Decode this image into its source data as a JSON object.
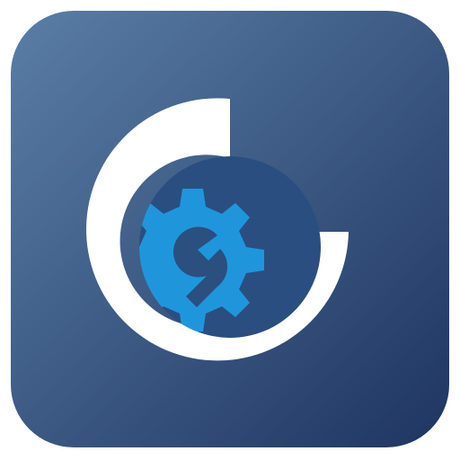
{
  "icon": {
    "name": "settings-gear-wrench-app-icon",
    "glyph_icon": "gear-wrench-icon",
    "colors": {
      "background_light": "#5A7EA6",
      "background_dark": "#1E3560",
      "ring": "#FFFFFF",
      "inner_disc": "#2A4E80",
      "gear": "#1F96DC",
      "wrench": "#2B4F7E"
    }
  }
}
